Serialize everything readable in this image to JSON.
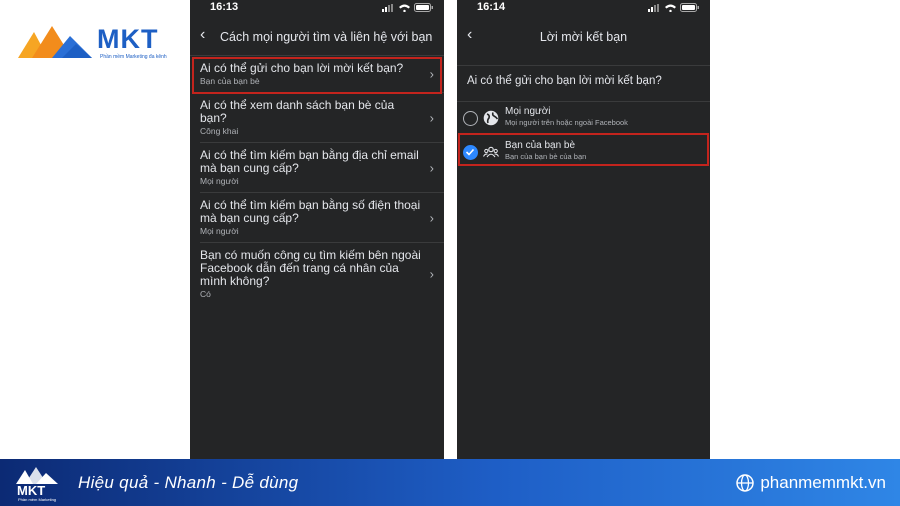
{
  "brand": {
    "name": "MKT",
    "tagline": "Phần mềm Marketing đa kênh",
    "footer_tagline": "Phần mềm Marketing"
  },
  "left_phone": {
    "time": "16:13",
    "title": "Cách mọi người tìm và liên hệ với bạn",
    "items": [
      {
        "question": "Ai có thể gửi cho bạn lời mời kết bạn?",
        "answer": "Bạn của bạn bè"
      },
      {
        "question": "Ai có thể xem danh sách bạn bè của bạn?",
        "answer": "Công khai"
      },
      {
        "question": "Ai có thể tìm kiếm bạn bằng địa chỉ email mà bạn cung cấp?",
        "answer": "Mọi người"
      },
      {
        "question": "Ai có thể tìm kiếm bạn bằng số điện thoại mà bạn cung cấp?",
        "answer": "Mọi người"
      },
      {
        "question": "Bạn có muốn công cụ tìm kiếm bên ngoài Facebook dẫn đến trang cá nhân của mình không?",
        "answer": "Có"
      }
    ]
  },
  "right_phone": {
    "time": "16:14",
    "title": "Lời mời kết bạn",
    "question": "Ai có thể gửi cho bạn lời mời kết bạn?",
    "options": [
      {
        "title": "Mọi người",
        "subtitle": "Mọi người trên hoặc ngoài Facebook",
        "icon": "globe-icon",
        "selected": false
      },
      {
        "title": "Bạn của bạn bè",
        "subtitle": "Bạn của bạn bè của bạn",
        "icon": "friends-icon",
        "selected": true
      }
    ]
  },
  "footer": {
    "slogan": "Hiệu quả - Nhanh  - Dễ dùng",
    "website": "phanmemmkt.vn"
  },
  "colors": {
    "highlight": "#c3241d",
    "accent": "#2d88ff",
    "phone_bg": "#242526"
  }
}
